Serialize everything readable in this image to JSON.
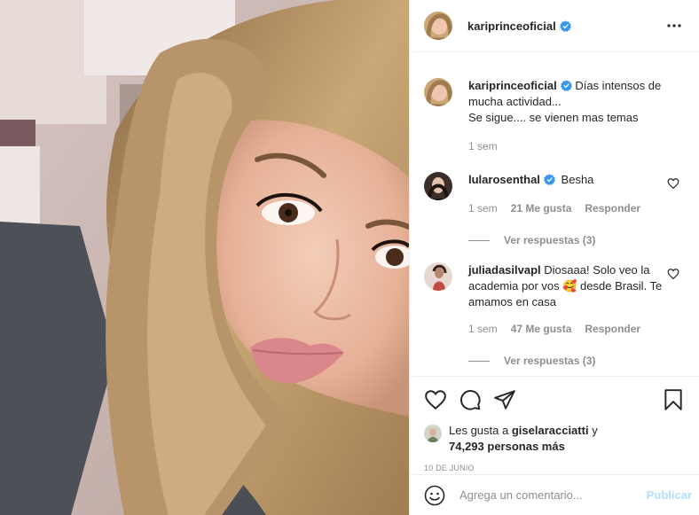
{
  "post": {
    "image_description_icon": "photo",
    "author": "kariprinceoficial",
    "verified": true
  },
  "header": {
    "username": "kariprinceoficial",
    "more_icon": "more-horizontal-icon"
  },
  "caption": {
    "username": "kariprinceoficial",
    "text_line1": "Días intensos de mucha actividad...",
    "text_line2": "Se sigue.... se vienen mas temas",
    "time": "1 sem"
  },
  "comments": [
    {
      "username": "lularosenthal",
      "verified": true,
      "text": "Besha",
      "time": "1 sem",
      "likes": "21 Me gusta",
      "reply": "Responder",
      "view_replies": "Ver respuestas (3)"
    },
    {
      "username": "juliadasilvapl",
      "verified": false,
      "text_before_emoji": "Diosaaa! Solo veo la academia por vos ",
      "emoji": "🥰",
      "text_after_emoji": " desde Brasil. Te amamos en casa",
      "time": "1 sem",
      "likes": "47 Me gusta",
      "reply": "Responder",
      "view_replies": "Ver respuestas (3)"
    }
  ],
  "likes": {
    "prefix": "Les gusta a",
    "user": "giselaracciatti",
    "conjunction": "y",
    "count": "74,293 personas más"
  },
  "date": "10 DE JUNIO",
  "composer": {
    "placeholder": "Agrega un comentario...",
    "publish": "Publicar"
  },
  "colors": {
    "verified": "#3897f0",
    "muted": "#8e8e8e",
    "publish_disabled": "#b2dffc",
    "border": "#efefef"
  }
}
